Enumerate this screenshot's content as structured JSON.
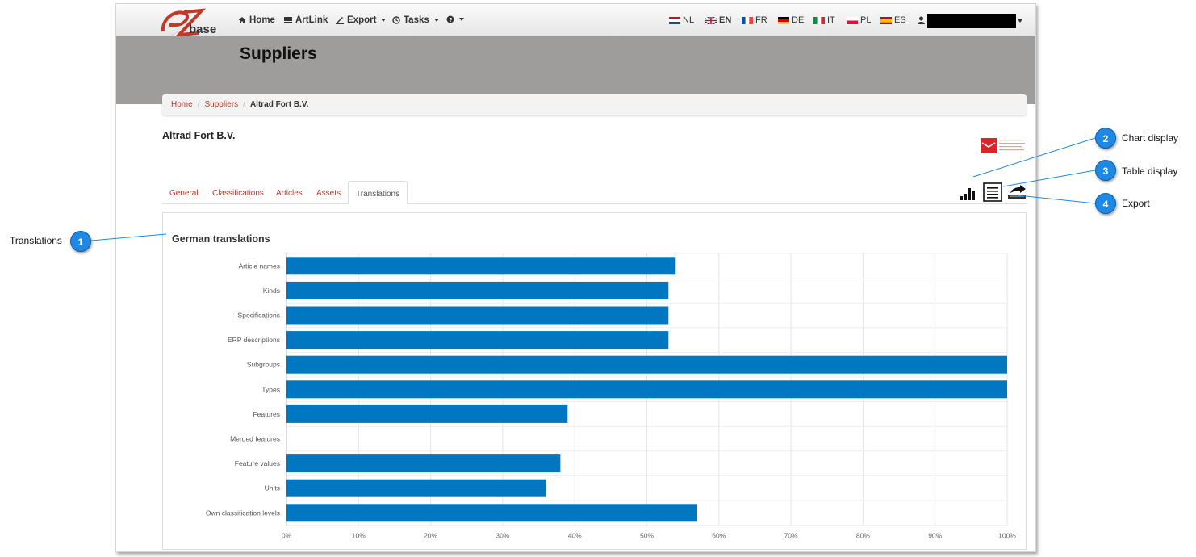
{
  "app": {
    "logo_text": "base",
    "logo_letter": "e"
  },
  "navbar": {
    "items": [
      {
        "label": "Home",
        "icon": "home-icon"
      },
      {
        "label": "ArtLink",
        "icon": "list-icon"
      },
      {
        "label": "Export",
        "icon": "export-icon",
        "dropdown": true
      },
      {
        "label": "Tasks",
        "icon": "clock-icon",
        "dropdown": true
      },
      {
        "label": "",
        "icon": "help-icon",
        "dropdown": true
      }
    ],
    "languages": [
      "NL",
      "EN",
      "FR",
      "DE",
      "IT",
      "PL",
      "ES"
    ],
    "user_icon": "user-icon"
  },
  "header": {
    "title": "Suppliers"
  },
  "breadcrumb": {
    "items": [
      "Home",
      "Suppliers"
    ],
    "active": "Altrad Fort B.V."
  },
  "supplier": {
    "name": "Altrad Fort B.V."
  },
  "tabs": [
    {
      "label": "General",
      "active": false
    },
    {
      "label": "Classifications",
      "active": false
    },
    {
      "label": "Articles",
      "active": false
    },
    {
      "label": "Assets",
      "active": false
    },
    {
      "label": "Translations",
      "active": true
    }
  ],
  "toolbar": {
    "icons": [
      "bar-chart-icon",
      "table-icon",
      "export-icon"
    ]
  },
  "callouts": [
    {
      "number": "1",
      "label": "Translations"
    },
    {
      "number": "2",
      "label": "Chart display"
    },
    {
      "number": "3",
      "label": "Table display"
    },
    {
      "number": "4",
      "label": "Export"
    }
  ],
  "colors": {
    "accent": "#c0392b",
    "bar": "#0077c0",
    "callout": "#1e88e5",
    "band": "#9e9d9b"
  },
  "chart_data": {
    "type": "bar",
    "orientation": "horizontal",
    "title": "German translations",
    "categories": [
      "Article names",
      "Kinds",
      "Specifications",
      "ERP descriptions",
      "Subgroups",
      "Types",
      "Features",
      "Merged features",
      "Feature values",
      "Units",
      "Own classification levels"
    ],
    "values": [
      54,
      53,
      53,
      53,
      100,
      100,
      39,
      0,
      38,
      36,
      57
    ],
    "xlim": [
      0,
      100
    ],
    "xticks": [
      "0%",
      "10%",
      "20%",
      "30%",
      "40%",
      "50%",
      "60%",
      "70%",
      "80%",
      "90%",
      "100%"
    ],
    "grid": true
  }
}
